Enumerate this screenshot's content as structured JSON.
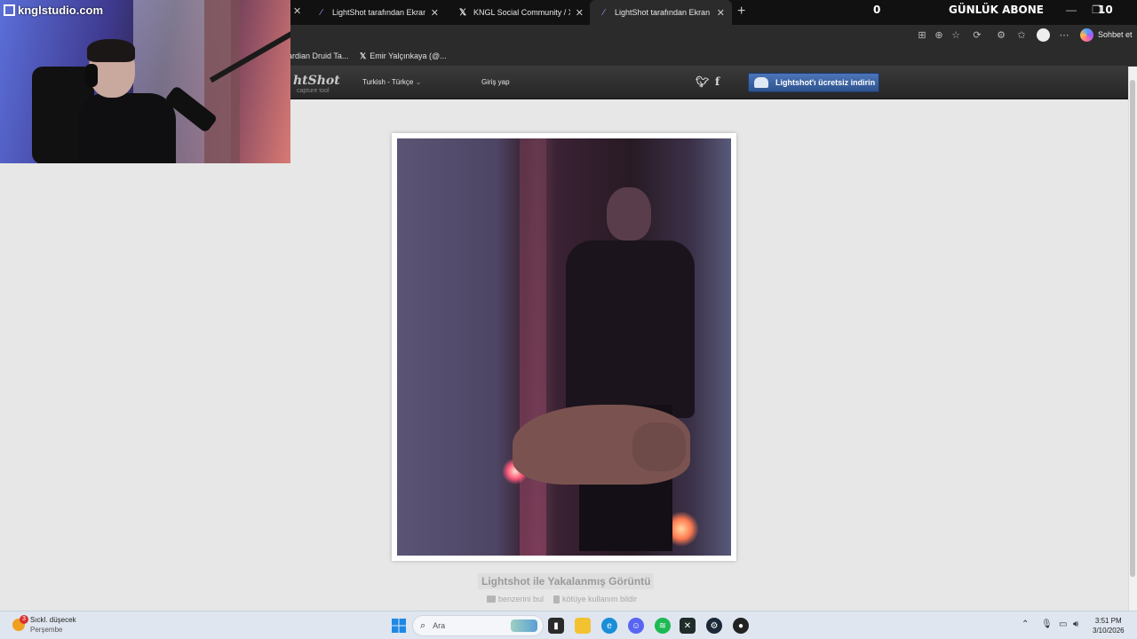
{
  "webcam": {
    "brand": "knglstudio.com"
  },
  "tabs": [
    {
      "title": "LightShot tarafından Ekran Görünt",
      "active": false
    },
    {
      "title": "KNGL Social Community / X",
      "active": false
    },
    {
      "title": "LightShot tarafından Ekran Görünt",
      "active": true
    }
  ],
  "overlay": {
    "count_left": "0",
    "label": "GÜNLÜK ABONE",
    "count_right": "10"
  },
  "toolbar": {
    "chat_label": "Sohbet et"
  },
  "bookmarks": [
    {
      "label": "ardian Druid Ta..."
    },
    {
      "label": "Emir Yalçınkaya (@..."
    }
  ],
  "lightshot": {
    "logo": "htShot",
    "logo_sub": "capture tool",
    "language": "Turkish - Türkçe",
    "login": "Giriş yap",
    "download_button": "Lightshot'ı ücretsiz indirin",
    "caption": "Lightshot ile Yakalanmış Görüntü",
    "find_similar": "benzerini bul",
    "report_abuse": "kötüye kullanım bildir"
  },
  "taskbar": {
    "weather_title": "Sıckl. düşecek",
    "weather_day": "Perşembe",
    "weather_badge": "3",
    "search_placeholder": "Ara",
    "time": "3:51 PM",
    "date": "3/10/2026"
  }
}
